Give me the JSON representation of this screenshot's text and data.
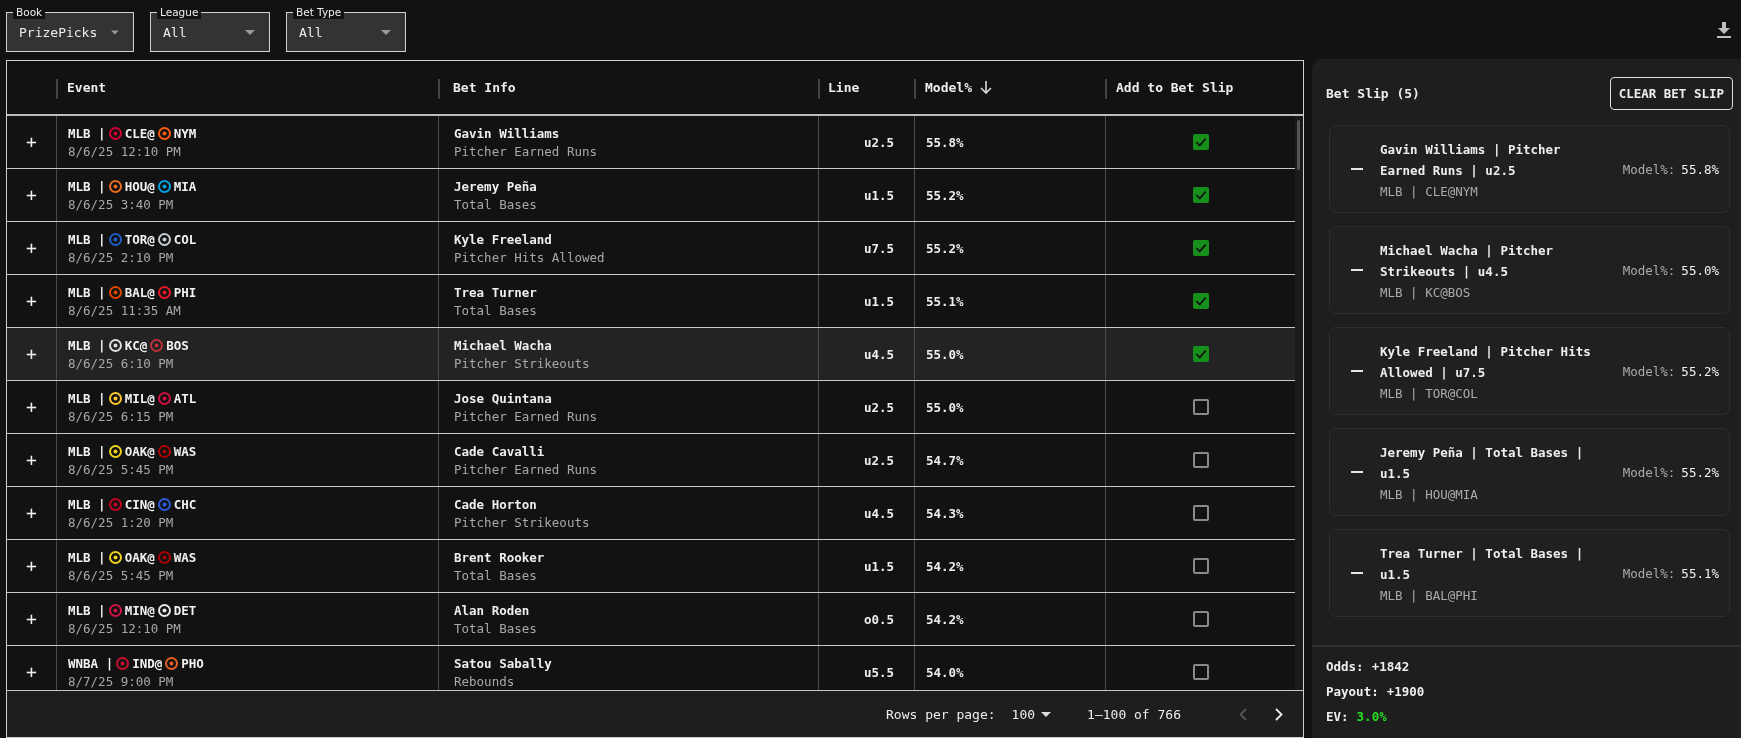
{
  "filters": [
    {
      "label": "Book",
      "value": "PrizePicks"
    },
    {
      "label": "League",
      "value": "All"
    },
    {
      "label": "Bet Type",
      "value": "All"
    }
  ],
  "table": {
    "columns": [
      {
        "label": "Event",
        "sorted": false
      },
      {
        "label": "Bet Info",
        "sorted": false
      },
      {
        "label": "Line",
        "sorted": false
      },
      {
        "label": "Model%",
        "sorted": true
      },
      {
        "label": "Add to Bet Slip",
        "sorted": false
      }
    ],
    "rows": [
      {
        "expand": "+",
        "league": "MLB |",
        "away": {
          "team": "CLE@",
          "color": "#d50032"
        },
        "home": {
          "team": "NYM",
          "color": "#ff5910"
        },
        "time": "8/6/25 12:10 PM",
        "player": "Gavin Williams",
        "market": "Pitcher Earned Runs",
        "line": "u2.5",
        "model": "55.8%",
        "checked": true,
        "hovered": false
      },
      {
        "expand": "+",
        "league": "MLB |",
        "away": {
          "team": "HOU@",
          "color": "#eb6e1f"
        },
        "home": {
          "team": "MIA",
          "color": "#00a3e0"
        },
        "time": "8/6/25 3:40 PM",
        "player": "Jeremy Peña",
        "market": "Total Bases",
        "line": "u1.5",
        "model": "55.2%",
        "checked": true,
        "hovered": false
      },
      {
        "expand": "+",
        "league": "MLB |",
        "away": {
          "team": "TOR@",
          "color": "#1d5fc4"
        },
        "home": {
          "team": "COL",
          "color": "#c4ced4"
        },
        "time": "8/6/25 2:10 PM",
        "player": "Kyle Freeland",
        "market": "Pitcher Hits Allowed",
        "line": "u7.5",
        "model": "55.2%",
        "checked": true,
        "hovered": false
      },
      {
        "expand": "+",
        "league": "MLB |",
        "away": {
          "team": "BAL@",
          "color": "#df4601"
        },
        "home": {
          "team": "PHI",
          "color": "#e81828"
        },
        "time": "8/6/25 11:35 AM",
        "player": "Trea Turner",
        "market": "Total Bases",
        "line": "u1.5",
        "model": "55.1%",
        "checked": true,
        "hovered": false
      },
      {
        "expand": "+",
        "league": "MLB |",
        "away": {
          "team": "KC@",
          "color": "#dddddd"
        },
        "home": {
          "team": "BOS",
          "color": "#bd3039"
        },
        "time": "8/6/25 6:10 PM",
        "player": "Michael Wacha",
        "market": "Pitcher Strikeouts",
        "line": "u4.5",
        "model": "55.0%",
        "checked": true,
        "hovered": true
      },
      {
        "expand": "+",
        "league": "MLB |",
        "away": {
          "team": "MIL@",
          "color": "#ffc52f"
        },
        "home": {
          "team": "ATL",
          "color": "#ce1141"
        },
        "time": "8/6/25 6:15 PM",
        "player": "Jose Quintana",
        "market": "Pitcher Earned Runs",
        "line": "u2.5",
        "model": "55.0%",
        "checked": false,
        "hovered": false
      },
      {
        "expand": "+",
        "league": "MLB |",
        "away": {
          "team": "OAK@",
          "color": "#efd21e"
        },
        "home": {
          "team": "WAS",
          "color": "#ab0003"
        },
        "time": "8/6/25 5:45 PM",
        "player": "Cade Cavalli",
        "market": "Pitcher Earned Runs",
        "line": "u2.5",
        "model": "54.7%",
        "checked": false,
        "hovered": false
      },
      {
        "expand": "+",
        "league": "MLB |",
        "away": {
          "team": "CIN@",
          "color": "#c6011f"
        },
        "home": {
          "team": "CHC",
          "color": "#2a5ad6"
        },
        "time": "8/6/25 1:20 PM",
        "player": "Cade Horton",
        "market": "Pitcher Strikeouts",
        "line": "u4.5",
        "model": "54.3%",
        "checked": false,
        "hovered": false
      },
      {
        "expand": "+",
        "league": "MLB |",
        "away": {
          "team": "OAK@",
          "color": "#efd21e"
        },
        "home": {
          "team": "WAS",
          "color": "#ab0003"
        },
        "time": "8/6/25 5:45 PM",
        "player": "Brent Rooker",
        "market": "Total Bases",
        "line": "u1.5",
        "model": "54.2%",
        "checked": false,
        "hovered": false
      },
      {
        "expand": "+",
        "league": "MLB |",
        "away": {
          "team": "MIN@",
          "color": "#d31145"
        },
        "home": {
          "team": "DET",
          "color": "#e8e8e8"
        },
        "time": "8/6/25 12:10 PM",
        "player": "Alan Roden",
        "market": "Total Bases",
        "line": "o0.5",
        "model": "54.2%",
        "checked": false,
        "hovered": false
      },
      {
        "expand": "+",
        "league": "WNBA |",
        "away": {
          "team": "IND@",
          "color": "#c8102e"
        },
        "home": {
          "team": "PHO",
          "color": "#e56020"
        },
        "time": "8/7/25 9:00 PM",
        "player": "Satou Sabally",
        "market": "Rebounds",
        "line": "u5.5",
        "model": "54.0%",
        "checked": false,
        "hovered": false
      }
    ],
    "pagination": {
      "rows_label": "Rows per page:",
      "rows_value": "100",
      "range": "1–100 of 766",
      "prev": {
        "disabled": true
      },
      "next": {
        "disabled": false
      }
    }
  },
  "bet_slip": {
    "title": "Bet Slip (5)",
    "clear_label": "CLEAR BET SLIP",
    "items": [
      {
        "title": "Gavin Williams | Pitcher Earned Runs | u2.5",
        "meta": "MLB | CLE@NYM",
        "model_label": "Model%:",
        "model_value": "55.8%"
      },
      {
        "title": "Michael Wacha | Pitcher Strikeouts | u4.5",
        "meta": "MLB | KC@BOS",
        "model_label": "Model%:",
        "model_value": "55.0%"
      },
      {
        "title": "Kyle Freeland | Pitcher Hits Allowed | u7.5",
        "meta": "MLB | TOR@COL",
        "model_label": "Model%:",
        "model_value": "55.2%"
      },
      {
        "title": "Jeremy Peña | Total Bases | u1.5",
        "meta": "MLB | HOU@MIA",
        "model_label": "Model%:",
        "model_value": "55.2%"
      },
      {
        "title": "Trea Turner | Total Bases | u1.5",
        "meta": "MLB | BAL@PHI",
        "model_label": "Model%:",
        "model_value": "55.1%"
      }
    ],
    "totals": [
      {
        "label": "Odds:",
        "value": "+1842",
        "positive": false
      },
      {
        "label": "Payout:",
        "value": "+1900",
        "positive": false
      },
      {
        "label": "EV:",
        "value": "3.0%",
        "positive": true
      }
    ]
  }
}
